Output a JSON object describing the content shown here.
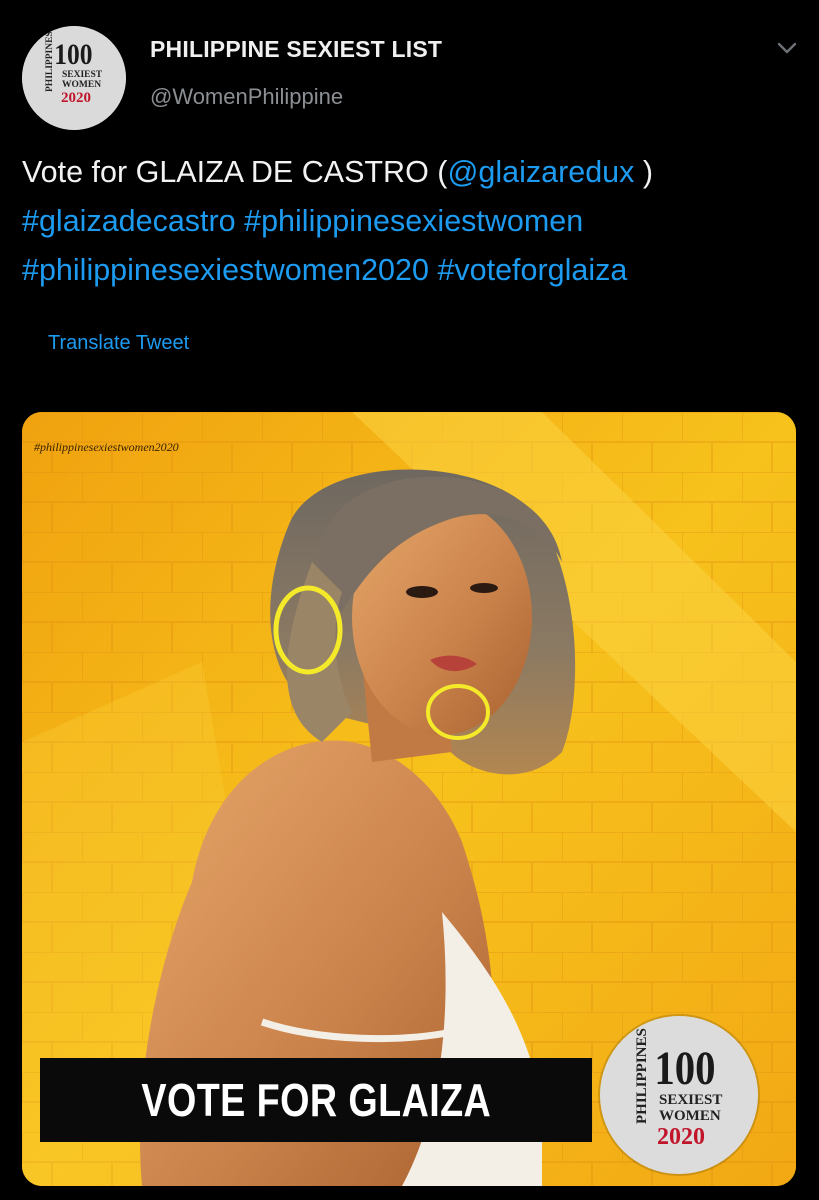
{
  "account": {
    "display_name": "PHILIPPINE SEXIEST LIST",
    "handle": "@WomenPhilippine"
  },
  "logo": {
    "side_text": "PHILIPPINES",
    "number": "100",
    "line1": "SEXIEST",
    "line2": "WOMEN",
    "year": "2020"
  },
  "tweet": {
    "prefix": "Vote for GLAIZA DE CASTRO (",
    "mention": "@glaizaredux",
    "suffix": " )",
    "hashtags": [
      "#glaizadecastro",
      "#philippinesexiestwomen",
      "#philippinesexiestwomen2020",
      "#voteforglaiza"
    ]
  },
  "translate_label": "Translate Tweet",
  "media": {
    "hashtag": "#philippinesexiestwomen2020",
    "banner_text": "VOTE FOR GLAIZA"
  },
  "icons": {
    "menu": "chevron-down-icon"
  },
  "colors": {
    "background": "#000000",
    "link": "#1d9bf0",
    "handle": "#8b8f93",
    "year_red": "#c0152a",
    "photo_yellow": "#f5b21a"
  }
}
